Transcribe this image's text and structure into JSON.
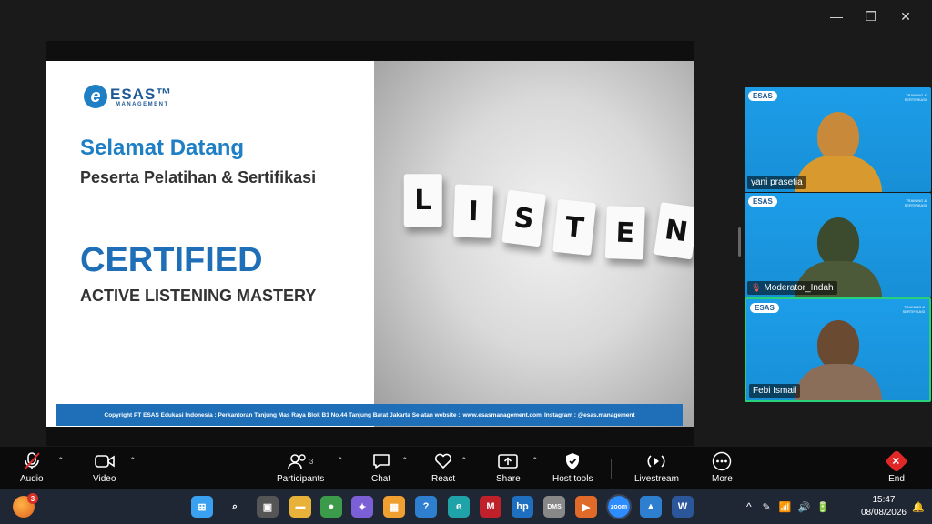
{
  "window": {
    "minimize": "—",
    "restore": "❐",
    "close": "✕"
  },
  "slide": {
    "logo_mark": "e",
    "logo_brand": "ESAS™",
    "logo_sub": "MANAGEMENT",
    "welcome": "Selamat Datang",
    "subtitle": "Peserta Pelatihan & Sertifikasi",
    "certified": "CERTIFIED",
    "course": "ACTIVE LISTENING MASTERY",
    "tiles": [
      "L",
      "I",
      "S",
      "T",
      "E",
      "N"
    ],
    "footer_prefix": "Copyright PT ESAS Edukasi Indonesia : Perkantoran Tanjung Mas Raya Blok B1 No.44 Tanjung Barat Jakarta Selatan website :",
    "footer_link": "www.esasmanagement.com",
    "footer_suffix": "Instagram : @esas.management"
  },
  "participants": [
    {
      "name": "yani prasetia",
      "mini_logo": "ESAS",
      "corner_tag": "TRAINING & SERTIFIKASI",
      "muted": false,
      "colors": {
        "head": "#c8893a",
        "body": "#d89a2e"
      }
    },
    {
      "name": "Moderator_Indah",
      "mini_logo": "ESAS",
      "corner_tag": "TRAINING & SERTIFIKASI",
      "muted": true,
      "colors": {
        "head": "#3c4a2e",
        "body": "#4d5a3a"
      }
    },
    {
      "name": "Febi Ismail",
      "mini_logo": "ESAS",
      "corner_tag": "TRAINING & SERTIFIKASI",
      "muted": false,
      "active": true,
      "colors": {
        "head": "#6b4a32",
        "body": "#8a6e5a"
      }
    }
  ],
  "toolbar": {
    "audio": "Audio",
    "video": "Video",
    "participants": "Participants",
    "participants_count": "3",
    "chat": "Chat",
    "react": "React",
    "share": "Share",
    "host_tools": "Host tools",
    "livestream": "Livestream",
    "more": "More",
    "end": "End",
    "end_glyph": "✕"
  },
  "taskbar": {
    "widget_badge": "3",
    "time": "15:47",
    "date": "08/08/2026",
    "apps": [
      {
        "name": "start-icon",
        "glyph": "⊞",
        "color": "#3aa0f0"
      },
      {
        "name": "search-icon",
        "glyph": "⌕",
        "color": "transparent"
      },
      {
        "name": "task-view-icon",
        "glyph": "▣",
        "color": "#555"
      },
      {
        "name": "file-explorer-icon",
        "glyph": "▬",
        "color": "#e8b13a"
      },
      {
        "name": "chrome-icon",
        "glyph": "●",
        "color": "#3c9b4a"
      },
      {
        "name": "copilot-icon",
        "glyph": "✦",
        "color": "#7b5fd6"
      },
      {
        "name": "store-icon",
        "glyph": "▦",
        "color": "#f0a030"
      },
      {
        "name": "help-icon",
        "glyph": "?",
        "color": "#2f7fd0"
      },
      {
        "name": "edge-icon",
        "glyph": "e",
        "color": "#1fa3a8"
      },
      {
        "name": "mcafee-icon",
        "glyph": "M",
        "color": "#c0202a"
      },
      {
        "name": "hp-icon",
        "glyph": "hp",
        "color": "#1f6fc0"
      },
      {
        "name": "dms-icon",
        "glyph": "DMS",
        "color": "#888"
      },
      {
        "name": "media-player-icon",
        "glyph": "▶",
        "color": "#e06a2a"
      },
      {
        "name": "zoom-icon",
        "glyph": "zoom",
        "color": "#2d8cff"
      },
      {
        "name": "photos-icon",
        "glyph": "▲",
        "color": "#2f7fd0"
      },
      {
        "name": "word-icon",
        "glyph": "W",
        "color": "#2b579a"
      }
    ],
    "tray": {
      "chevron": "^",
      "wifi": "📶",
      "volume": "🔊",
      "battery": "🔋",
      "bell": "🔔"
    }
  }
}
